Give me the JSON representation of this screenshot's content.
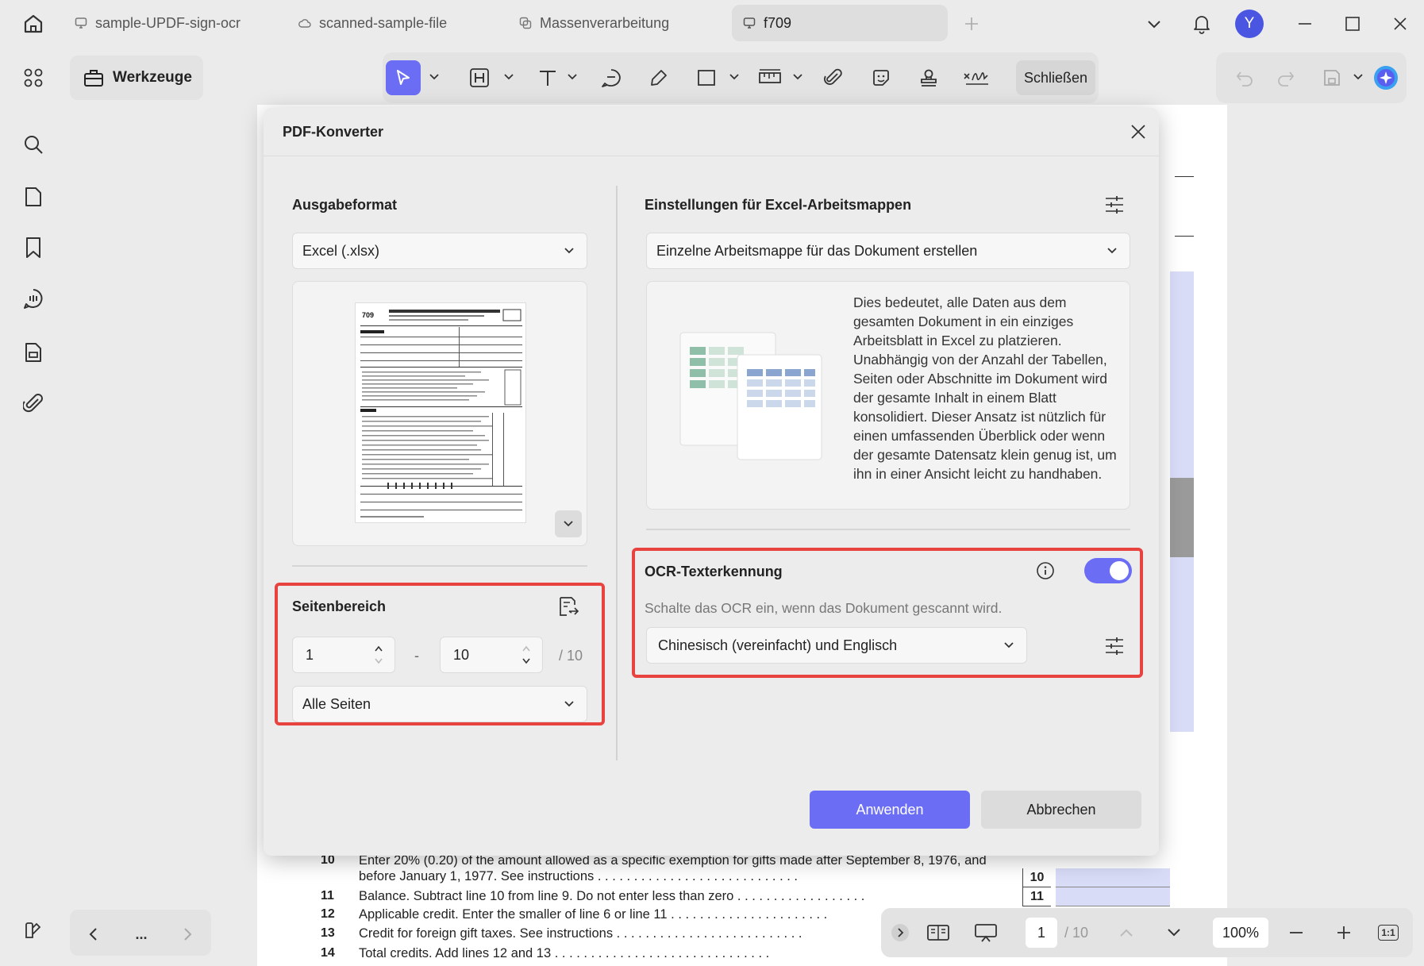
{
  "tabs": [
    {
      "label": "sample-UPDF-sign-ocr",
      "icon": "monitor-icon"
    },
    {
      "label": "scanned-sample-file",
      "icon": "cloud-icon"
    },
    {
      "label": "Massenverarbeitung",
      "icon": "copy-icon"
    },
    {
      "label": "f709",
      "icon": "monitor-icon",
      "active": true
    }
  ],
  "user": {
    "avatar_letter": "Y"
  },
  "toolbar": {
    "tools_label": "Werkzeuge",
    "close_label": "Schließen"
  },
  "document": {
    "lines": [
      {
        "num": "10",
        "text": "Enter 20% (0.20) of the amount allowed as a specific exemption for gifts made after September 8, 1976, and",
        "box": ""
      },
      {
        "num": "",
        "text": "before January 1, 1977. See instructions  .  .  .  .  .  .  .  .  .  .  .  .  .  .  .  .  .  .  .  .  .  .  .  .  .  .  .  .",
        "box": "10"
      },
      {
        "num": "11",
        "text": "Balance. Subtract line 10 from line 9. Do not enter less than zero  .  .  .  .  .  .  .  .  .  .  .  .  .  .  .  .  .  .",
        "box": "11"
      },
      {
        "num": "12",
        "text": "Applicable credit. Enter the smaller of line 6 or line 11  .  .  .  .  .  .  .  .  .  .  .  .  .  .  .  .  .  .  .  .  .  .",
        "box": "12"
      },
      {
        "num": "13",
        "text": "Credit for foreign gift taxes. See instructions  .  .  .  .  .  .  .  .  .  .  .  .  .  .  .  .  .  .  .  .  .  .  .  .  .  .",
        "box": "13"
      },
      {
        "num": "14",
        "text": "Total credits. Add lines 12 and 13  .  .  .  .  .  .  .  .  .  .  .  .  .  .  .  .  .  .  .  .  .  .  .  .  .  .  .  .  .  .",
        "box": "14"
      }
    ]
  },
  "pager": {
    "current_page": "1",
    "total": "/ 10",
    "zoom": "100%",
    "fit_label": "1:1",
    "more": "..."
  },
  "dialog": {
    "title": "PDF-Konverter",
    "output_format_label": "Ausgabeformat",
    "output_format_value": "Excel (.xlsx)",
    "excel_settings_label": "Einstellungen für Excel-Arbeitsmappen",
    "workbook_option": "Einzelne Arbeitsmappe für das Dokument erstellen",
    "workbook_description": "Dies bedeutet, alle Daten aus dem gesamten Dokument in ein einziges Arbeitsblatt in Excel zu platzieren. Unabhängig von der Anzahl der Tabellen, Seiten oder Abschnitte im Dokument wird der gesamte Inhalt in einem Blatt konsolidiert. Dieser Ansatz ist nützlich für einen umfassenden Überblick oder wenn der gesamte Datensatz klein genug ist, um ihn in einer Ansicht leicht zu handhaben.",
    "page_range_label": "Seitenbereich",
    "range_from": "1",
    "range_separator": "-",
    "range_to": "10",
    "range_total": "/ 10",
    "page_subset": "Alle Seiten",
    "ocr_label": "OCR-Texterkennung",
    "ocr_enabled": true,
    "ocr_hint": "Schalte das OCR ein, wenn das Dokument gescannt wird.",
    "ocr_language": "Chinesisch (vereinfacht) und Englisch",
    "apply_label": "Anwenden",
    "cancel_label": "Abbrechen"
  },
  "colors": {
    "accent": "#6b6df5",
    "highlight_border": "#e8433f",
    "avatar": "#4a56e2"
  }
}
